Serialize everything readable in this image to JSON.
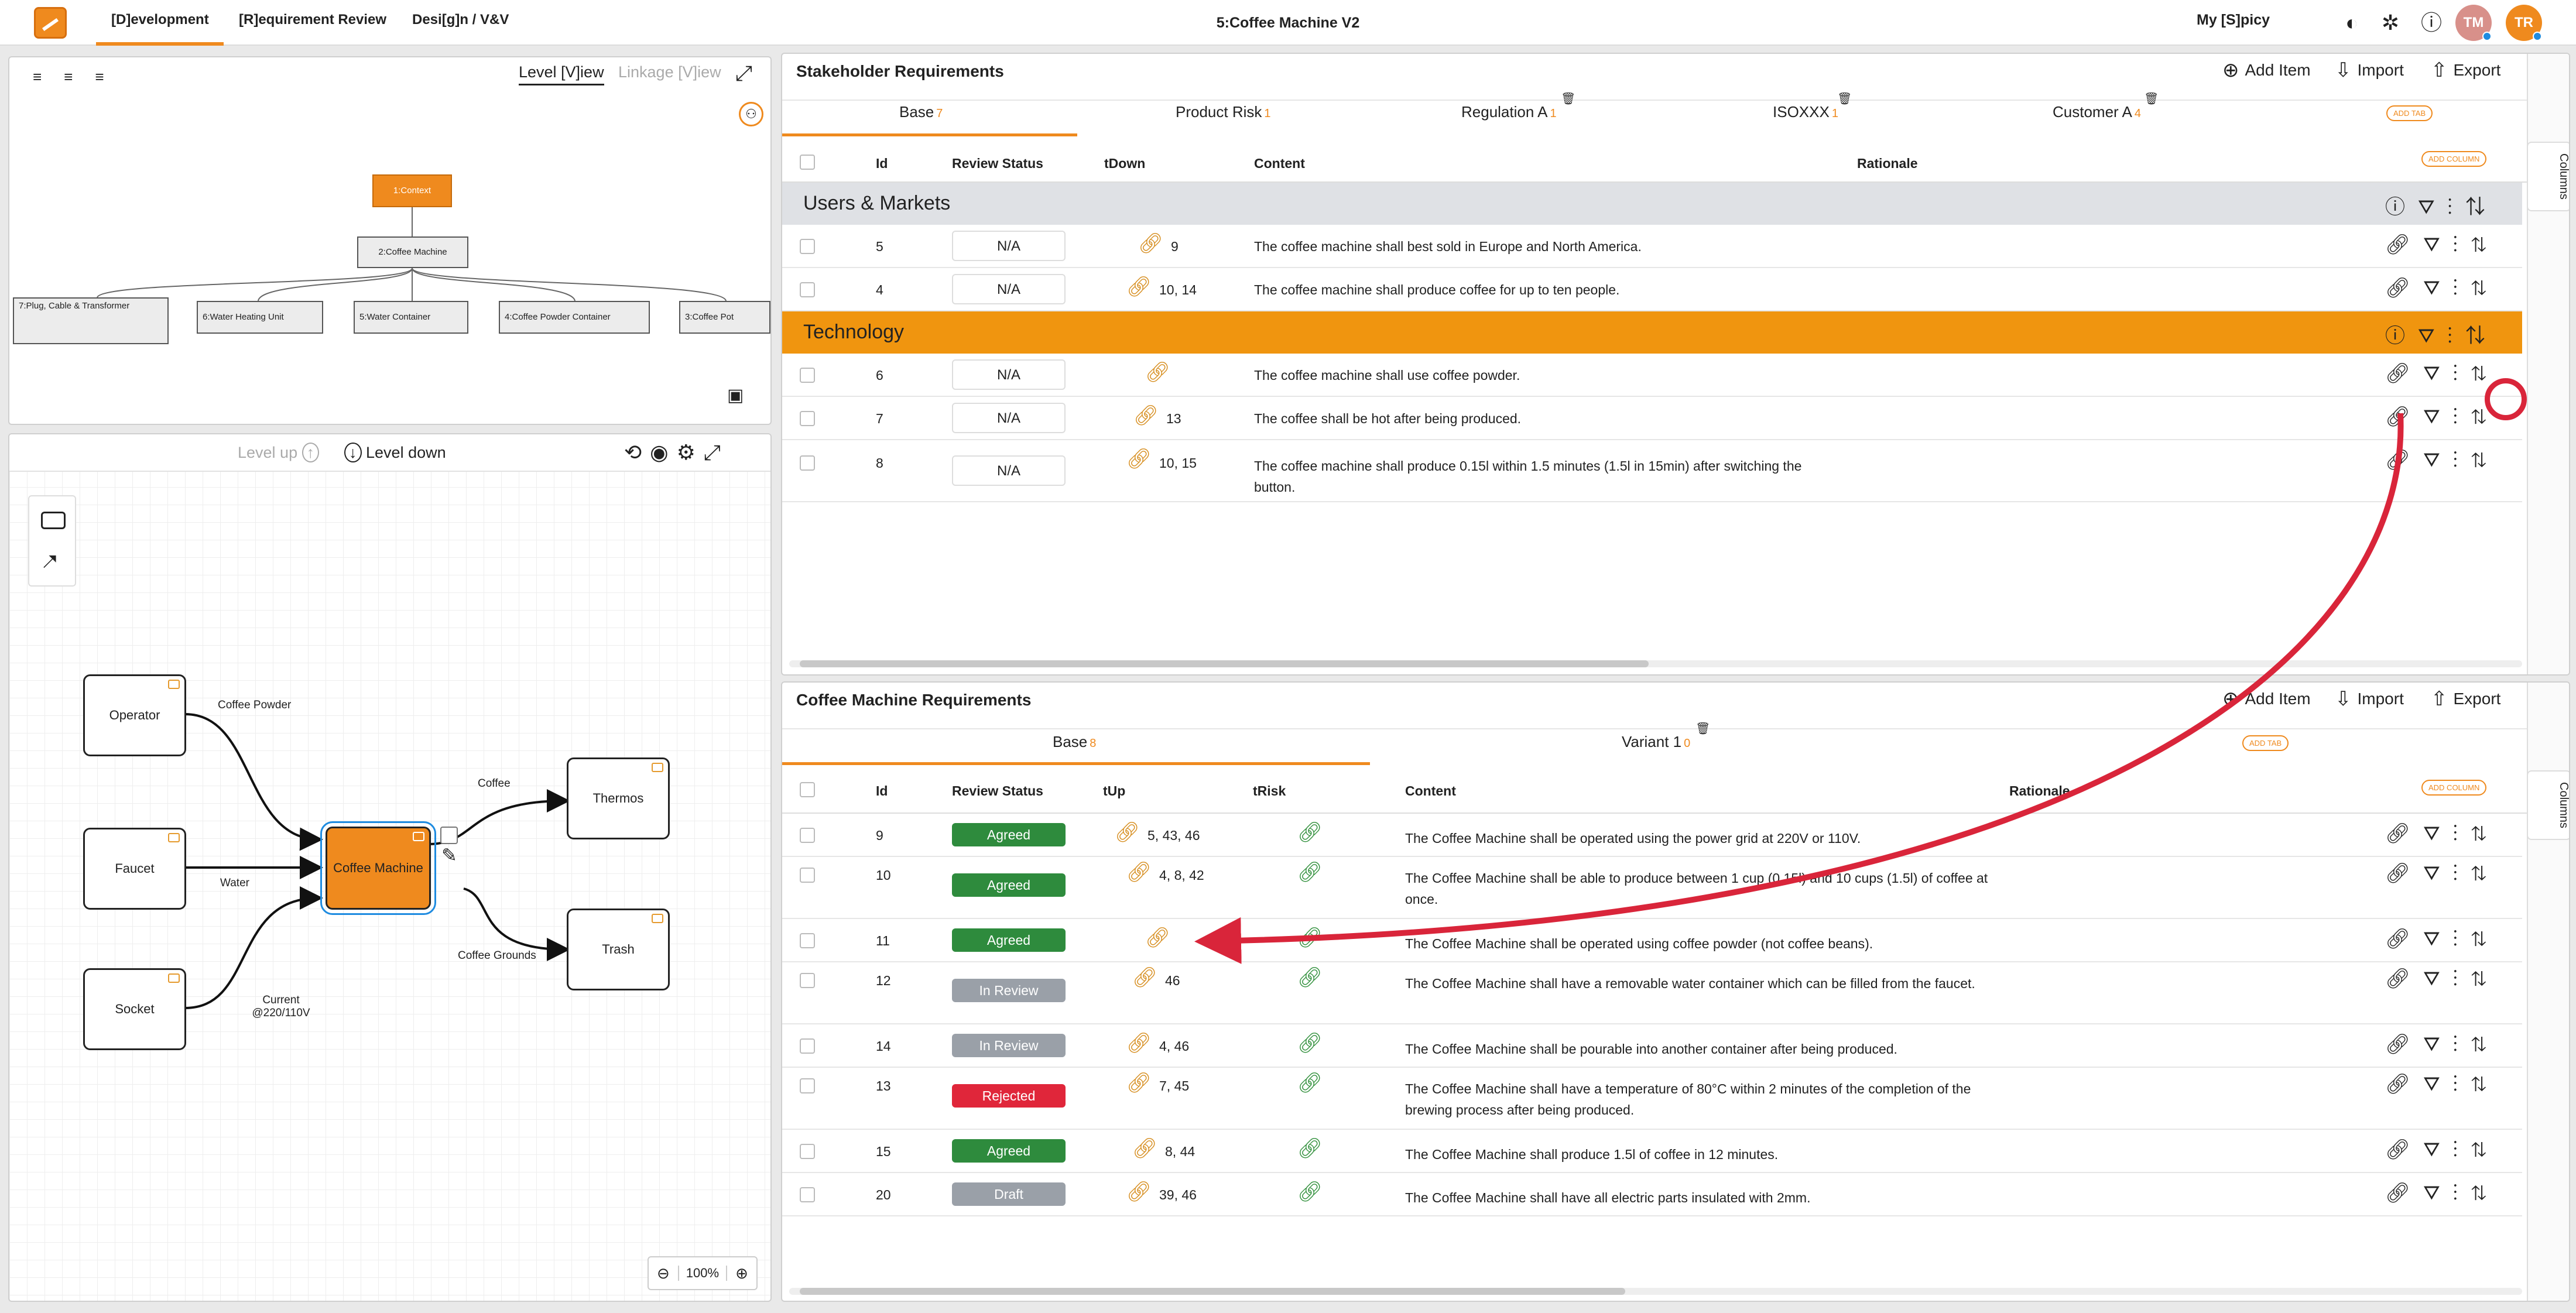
{
  "app": {
    "title": "5:Coffee Machine V2",
    "nav_tabs": [
      "[D]evelopment",
      "[R]equirement Review",
      "Desi[g]n / V&V"
    ],
    "my_spicy": "My [S]picy",
    "avatars": [
      {
        "initials": "TM",
        "color": "#d8908a"
      },
      {
        "initials": "TR",
        "color": "#ef8a1e"
      }
    ]
  },
  "tree_panel": {
    "view_tabs": [
      "Level [V]iew",
      "Linkage [V]iew"
    ],
    "nodes": [
      "1:Context",
      "2:Coffee Machine",
      "7:Plug, Cable & Transformer",
      "6:Water Heating Unit",
      "5:Water Container",
      "4:Coffee Powder Container",
      "3:Coffee Pot"
    ]
  },
  "diagram_panel": {
    "level_up": "Level up",
    "level_down": "Level down",
    "zoom": "100%",
    "nodes": [
      "Operator",
      "Faucet",
      "Socket",
      "Coffee Machine",
      "Thermos",
      "Trash"
    ],
    "edge_labels": [
      "Coffee Powder",
      "Water",
      "Current @220/110V",
      "Coffee",
      "Coffee Grounds"
    ]
  },
  "stakeholder": {
    "title": "Stakeholder Requirements",
    "add_item": "Add Item",
    "import": "Import",
    "export": "Export",
    "tabs": [
      {
        "label": "Base",
        "count": "7"
      },
      {
        "label": "Product Risk",
        "count": "1"
      },
      {
        "label": "Regulation A",
        "count": "1"
      },
      {
        "label": "ISOXXX",
        "count": "1"
      },
      {
        "label": "Customer A",
        "count": "4"
      }
    ],
    "add_tab": "ADD TAB",
    "add_column": "ADD COLUMN",
    "columns_tab": "Columns",
    "headers": [
      "Id",
      "Review Status",
      "tDown",
      "Content",
      "Rationale"
    ],
    "groups": [
      {
        "name": "Users & Markets",
        "rows": [
          {
            "id": "5",
            "status": "N/A",
            "tdown": "9",
            "content": "The coffee machine shall best sold in Europe and North America."
          },
          {
            "id": "4",
            "status": "N/A",
            "tdown": "10, 14",
            "content": "The coffee machine shall produce coffee for up to ten people."
          }
        ]
      },
      {
        "name": "Technology",
        "rows": [
          {
            "id": "6",
            "status": "N/A",
            "tdown": "",
            "content": "The coffee machine shall use coffee powder."
          },
          {
            "id": "7",
            "status": "N/A",
            "tdown": "13",
            "content": "The coffee shall be hot after being produced."
          },
          {
            "id": "8",
            "status": "N/A",
            "tdown": "10, 15",
            "content": "The coffee machine shall produce 0.15l within 1.5 minutes (1.5l in 15min) after switching the button."
          }
        ]
      }
    ]
  },
  "coffee": {
    "title": "Coffee Machine Requirements",
    "add_item": "Add Item",
    "import": "Import",
    "export": "Export",
    "tabs": [
      {
        "label": "Base",
        "count": "8"
      },
      {
        "label": "Variant 1",
        "count": "0"
      }
    ],
    "add_tab": "ADD TAB",
    "add_column": "ADD COLUMN",
    "columns_tab": "Columns",
    "headers": [
      "Id",
      "Review Status",
      "tUp",
      "tRisk",
      "Content",
      "Rationale"
    ],
    "rows": [
      {
        "id": "9",
        "status": "Agreed",
        "tup": "5, 43, 46",
        "content": "The Coffee Machine shall be operated using the power grid at 220V or 110V."
      },
      {
        "id": "10",
        "status": "Agreed",
        "tup": "4, 8, 42",
        "content": "The Coffee Machine shall be able to produce between 1 cup (0.15l) and 10 cups (1.5l) of coffee at once."
      },
      {
        "id": "11",
        "status": "Agreed",
        "tup": "",
        "content": "The Coffee Machine shall be operated using coffee powder (not coffee beans)."
      },
      {
        "id": "12",
        "status": "In Review",
        "tup": "46",
        "content": "The Coffee Machine shall have a removable water container which can be filled from the faucet."
      },
      {
        "id": "14",
        "status": "In Review",
        "tup": "4, 46",
        "content": "The Coffee Machine shall be pourable into another container after being produced."
      },
      {
        "id": "13",
        "status": "Rejected",
        "tup": "7, 45",
        "content": "The Coffee Machine shall have a temperature of 80°C within 2 minutes of the completion of the brewing process after being produced."
      },
      {
        "id": "15",
        "status": "Agreed",
        "tup": "8, 44",
        "content": "The Coffee Machine shall produce 1.5l of coffee in 12 minutes."
      },
      {
        "id": "20",
        "status": "Draft",
        "tup": "39, 46",
        "content": "The Coffee Machine shall have all electric parts insulated with 2mm."
      }
    ]
  },
  "status_colors": {
    "Agreed": "#2e8b3d",
    "In Review": "#9aa0a8",
    "Rejected": "#e0263a",
    "Draft": "#9aa0a8"
  },
  "colors": {
    "accent": "#ef8a1e",
    "annotation": "#d9253a"
  }
}
